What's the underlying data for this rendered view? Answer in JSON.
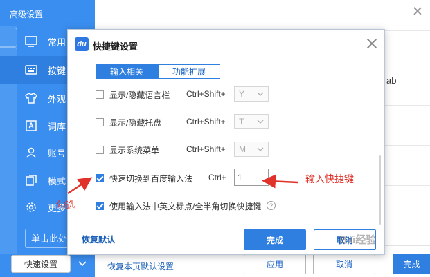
{
  "background": {
    "window_title": "高级设置",
    "nav": [
      {
        "label": "常用",
        "icon": "monitor-icon"
      },
      {
        "label": "按键",
        "icon": "keyboard-icon"
      },
      {
        "label": "外观",
        "icon": "shirt-icon"
      },
      {
        "label": "词库",
        "icon": "dictionary-icon"
      },
      {
        "label": "账号",
        "icon": "user-icon"
      },
      {
        "label": "模式",
        "icon": "layers-icon"
      },
      {
        "label": "更多",
        "icon": "gear-icon"
      }
    ],
    "search_placeholder": "单击此处",
    "quick_settings_label": "快速设置",
    "content_partial_text": "ab",
    "restore_page_label": "恢复本页默认设置",
    "apply_label": "应用",
    "cancel_label": "取消",
    "done_label": "完成"
  },
  "dialog": {
    "logo_text": "du",
    "title": "快捷键设置",
    "tabs": [
      {
        "label": "输入相关",
        "active": true
      },
      {
        "label": "功能扩展",
        "active": false
      }
    ],
    "rows": [
      {
        "label": "显示/隐藏语言栏",
        "checked": false,
        "modifier": "Ctrl+Shift+",
        "key": "Y",
        "enabled": false
      },
      {
        "label": "显示/隐藏托盘",
        "checked": false,
        "modifier": "Ctrl+Shift+",
        "key": "T",
        "enabled": false
      },
      {
        "label": "显示系统菜单",
        "checked": false,
        "modifier": "Ctrl+Shift+",
        "key": "M",
        "enabled": false
      },
      {
        "label": "快速切换到百度输入法",
        "checked": true,
        "modifier": "Ctrl+",
        "key": "1",
        "enabled": true
      },
      {
        "label": "使用输入法中英文标点/全半角切换快捷键",
        "checked": true
      }
    ],
    "help_glyph": "?",
    "restore_default_label": "恢复默认",
    "done_label": "完成",
    "cancel_label": "取消"
  },
  "annotations": {
    "check_note": "勾选",
    "input_note": "输入快捷键",
    "color": "#e0322a"
  },
  "watermark": "Bai经验"
}
